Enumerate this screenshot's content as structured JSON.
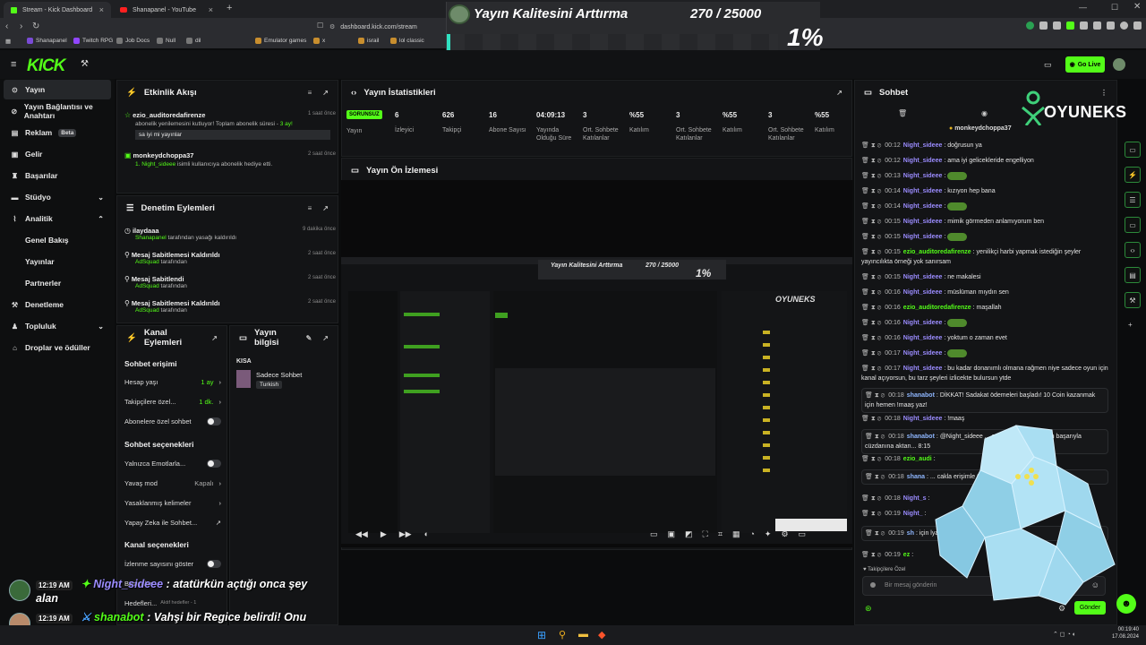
{
  "browser": {
    "tabs": [
      {
        "label": "Stream - Kick Dashboard",
        "active": true
      },
      {
        "label": "Shanapanel - YouTube",
        "active": false
      }
    ],
    "url": "dashboard.kick.com/stream",
    "bookmarks": [
      "Shanapanel",
      "Twitch RPG",
      "Job Docs",
      "Null",
      "dil",
      "Emulator games",
      "x",
      "israil",
      "lol classic"
    ]
  },
  "overlay_banner": {
    "title": "Yayın Kalitesini Arttırma",
    "count": "270 / 25000",
    "percent_label": "1%",
    "progress": 0.011
  },
  "kick": {
    "logo": "KICK",
    "go_live": "Go Live"
  },
  "sidebar": {
    "items": [
      {
        "label": "Yayın",
        "icon": "broadcast-icon"
      },
      {
        "label": "Yayın Bağlantısı ve Anahtarı",
        "icon": "link-icon"
      },
      {
        "label": "Reklam",
        "icon": "ads-icon",
        "badge": "Beta"
      },
      {
        "label": "Gelir",
        "icon": "money-icon"
      },
      {
        "label": "Başarılar",
        "icon": "trophy-icon"
      },
      {
        "label": "Stüdyo",
        "icon": "studio-icon"
      },
      {
        "label": "Analitik",
        "icon": "chart-icon"
      },
      {
        "label": "Genel Bakış"
      },
      {
        "label": "Yayınlar"
      },
      {
        "label": "Partnerler"
      },
      {
        "label": "Denetleme",
        "icon": "shield-icon"
      },
      {
        "label": "Topluluk",
        "icon": "people-icon"
      },
      {
        "label": "Droplar ve ödüller",
        "icon": "gift-icon"
      }
    ]
  },
  "activity": {
    "title": "Etkinlik Akışı",
    "items": [
      {
        "user": "ezio_auditoredafirenze",
        "time": "1 saat önce",
        "text": "abonelik yenilemesini kutluyor! Toplam abonelik süresi - ",
        "months": "3 ay!",
        "message": "sa iyi mi yayınlar"
      },
      {
        "user": "monkeydchoppa37",
        "time": "2 saat önce",
        "text_prefix": "1. ",
        "gifted_user": "Night_sideee",
        "text": " isimli kullanıcıya abonelik hediye etti."
      }
    ]
  },
  "moderation": {
    "title": "Denetim Eylemleri",
    "items": [
      {
        "title": "ilaydaaa",
        "actor": "Shanapanel",
        "suffix": " tarafından yasağı kaldırıldı",
        "time": "9 dakika önce",
        "icon": "clock-icon"
      },
      {
        "title": "Mesaj Sabitlemesi Kaldırıldı",
        "actor": "AdSquad",
        "suffix": " tarafından",
        "time": "2 saat önce",
        "icon": "pin-off-icon"
      },
      {
        "title": "Mesaj Sabitlendi",
        "actor": "AdSquad",
        "suffix": " tarafından",
        "time": "2 saat önce",
        "icon": "pin-icon"
      },
      {
        "title": "Mesaj Sabitlemesi Kaldırıldı",
        "actor": "AdSquad",
        "suffix": " tarafından",
        "time": "2 saat önce",
        "icon": "pin-off-icon"
      }
    ]
  },
  "channel_actions": {
    "title": "Kanal Eylemleri",
    "chat_access": "Sohbet erişimi",
    "rows1": [
      {
        "label": "Hesap yaşı",
        "value": "1 ay",
        "kind": "chevron"
      },
      {
        "label": "Takipçilere özel...",
        "value": "1 dk.",
        "kind": "chevron"
      },
      {
        "label": "Abonelere özel sohbet",
        "kind": "toggle"
      }
    ],
    "chat_options": "Sohbet seçenekleri",
    "rows2": [
      {
        "label": "Yalnızca Emotlarla...",
        "kind": "toggle"
      },
      {
        "label": "Yavaş mod",
        "value": "Kapalı",
        "kind": "chevron"
      },
      {
        "label": "Yasaklanmış kelimeler",
        "kind": "chevron"
      },
      {
        "label": "Yapay Zeka ile Sohbet...",
        "kind": "external"
      }
    ],
    "channel_options": "Kanal seçenekleri",
    "rows3": [
      {
        "label": "İzlenme sayısını göster",
        "kind": "toggle"
      },
      {
        "label": "Baskınlar"
      },
      {
        "label": "Hedefleri...",
        "note": "Aktif hedefler - 1"
      }
    ]
  },
  "stream_info": {
    "title": "Yayın bilgisi",
    "label": "KISA",
    "category": "Sadece Sohbet",
    "tag": "Turkish"
  },
  "stats": {
    "title": "Yayın İstatistikleri",
    "status": "SORUNSUZ",
    "status_label": "Yayın",
    "items": [
      {
        "value": "6",
        "label": "İzleyici"
      },
      {
        "value": "626",
        "label": "Takipçi"
      },
      {
        "value": "16",
        "label": "Abone Sayısı"
      },
      {
        "value": "04:09:13",
        "label": "Yayında Olduğu Süre"
      },
      {
        "value": "3",
        "label": "Ort. Sohbete Katılanlar"
      },
      {
        "value": "%55",
        "label": "Katılım"
      },
      {
        "value": "3",
        "label": "Ort. Sohbete Katılanlar"
      },
      {
        "value": "%55",
        "label": "Katılım"
      },
      {
        "value": "3",
        "label": "Ort. Sohbete Katılanlar"
      },
      {
        "value": "%55",
        "label": "Katılım"
      }
    ]
  },
  "preview": {
    "title": "Yayın Ön İzlemesi",
    "inner_title": "Yayın Kalitesini Arttırma",
    "inner_count": "270 / 25000",
    "inner_pct": "1%"
  },
  "chat": {
    "title": "Sohbet",
    "pinned_user": "monkeydchoppa37",
    "brand": "OYUNEKS",
    "messages": [
      {
        "time": "00:12",
        "user": "Night_sideee",
        "cls": "u-n",
        "text": "doğrusun ya"
      },
      {
        "time": "00:12",
        "user": "Night_sideee",
        "cls": "u-n",
        "text": "ama iyi gelicekleride engelliyon"
      },
      {
        "time": "00:13",
        "user": "Night_sideee",
        "cls": "u-n",
        "text": "",
        "emote": true
      },
      {
        "time": "00:14",
        "user": "Night_sideee",
        "cls": "u-n",
        "text": "kızıyon hep bana"
      },
      {
        "time": "00:14",
        "user": "Night_sideee",
        "cls": "u-n",
        "text": "",
        "emote": true
      },
      {
        "time": "00:15",
        "user": "Night_sideee",
        "cls": "u-n",
        "text": "mimik görmeden anlamıyorum ben"
      },
      {
        "time": "00:15",
        "user": "Night_sideee",
        "cls": "u-n",
        "text": "",
        "emote": true
      },
      {
        "time": "00:15",
        "user": "ezio_auditoredafirenze",
        "cls": "u-e",
        "text": "yenilikçi harbi yapmak istediğin şeyler yayıncılıkta örneği yok sanırsam"
      },
      {
        "time": "00:15",
        "user": "Night_sideee",
        "cls": "u-n",
        "text": "ne makalesi"
      },
      {
        "time": "00:16",
        "user": "Night_sideee",
        "cls": "u-n",
        "text": "müslüman mıydın sen"
      },
      {
        "time": "00:16",
        "user": "ezio_auditoredafirenze",
        "cls": "u-e",
        "text": "maşallah"
      },
      {
        "time": "00:16",
        "user": "Night_sideee",
        "cls": "u-n",
        "text": "",
        "emote": true
      },
      {
        "time": "00:16",
        "user": "Night_sideee",
        "cls": "u-n",
        "text": "yoktum o zaman evet"
      },
      {
        "time": "00:17",
        "user": "Night_sideee",
        "cls": "u-n",
        "text": "",
        "emote": true
      },
      {
        "time": "00:17",
        "user": "Night_sideee",
        "cls": "u-n",
        "text": "bu kadar donanımlı olmana rağmen niye sadece oyun için kanal açıyorsun, bu tarz şeyleri izlicekte bulursun ytde"
      },
      {
        "time": "00:18",
        "user": "shanabot",
        "cls": "u-s",
        "text": "DİKKAT! Sadakat ödemeleri başladı! 10 Coin kazanmak için hemen !maaş yaz!",
        "boxed": true
      },
      {
        "time": "00:18",
        "user": "Night_sideee",
        "cls": "u-n",
        "text": "!maaş"
      },
      {
        "time": "00:18",
        "user": "shanabot",
        "cls": "u-s",
        "text": "@Night_sideee ... cakla erişimle 60 Birim başarıyla cüzdanına aktarı... 8:15",
        "boxed": true
      },
      {
        "time": "00:18",
        "user": "ezio_audi",
        "cls": "u-e",
        "text": ""
      },
      {
        "time": "00:18",
        "user": "shana",
        "cls": "u-s",
        "text": "... cakla erişimle 60 Birim başarıyla cüzdanına ak...",
        "boxed": true
      },
      {
        "time": "00:18",
        "user": "Night_s",
        "cls": "u-n",
        "text": ""
      },
      {
        "time": "00:19",
        "user": "Night_",
        "cls": "u-n",
        "text": ""
      },
      {
        "time": "00:19",
        "user": "sh",
        "cls": "u-s",
        "text": "için lyakala komutunu ...",
        "boxed": true
      },
      {
        "time": "00:19",
        "user": "ez",
        "cls": "u-e",
        "text": ""
      }
    ],
    "followers_only": "Takipçilere Özel",
    "input_placeholder": "Bir mesaj gönderin",
    "send": "Gönder"
  },
  "stream_overlay": [
    {
      "time": "12:19 AM",
      "user": "Night_sideee",
      "text": ": atatürkün açtığı onca şey alan"
    },
    {
      "time": "12:19 AM",
      "user": "shanabot",
      "text": ": Vahşi bir Regice belirdi! Onu yakalamayı denemek için !yakala komutunu kullan!"
    }
  ],
  "taskbar": {
    "time": "00:19:40",
    "date": "17.08.2024"
  }
}
